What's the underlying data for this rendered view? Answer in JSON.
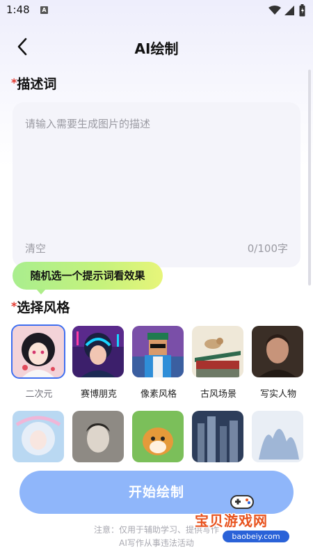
{
  "status_bar": {
    "time": "1:48",
    "notification_icon": "A"
  },
  "header": {
    "title": "AI绘制",
    "back_icon": "chevron-left"
  },
  "description": {
    "label": "描述词",
    "required_mark": "*",
    "placeholder": "请输入需要生成图片的描述",
    "clear_label": "清空",
    "counter": "0/100字"
  },
  "random_prompt_button": "随机选一个提示词看效果",
  "styles": {
    "label": "选择风格",
    "required_mark": "*",
    "items": [
      {
        "label": "二次元",
        "selected": true
      },
      {
        "label": "赛博朋克",
        "selected": false
      },
      {
        "label": "像素风格",
        "selected": false
      },
      {
        "label": "古风场景",
        "selected": false
      },
      {
        "label": "写实人物",
        "selected": false
      },
      {
        "label": "",
        "selected": false
      },
      {
        "label": "",
        "selected": false
      },
      {
        "label": "",
        "selected": false
      },
      {
        "label": "",
        "selected": false
      },
      {
        "label": "",
        "selected": false
      }
    ]
  },
  "start_button": "开始绘制",
  "notice": {
    "line1": "注意：仅用于辅助学习、提供写作",
    "line2": "AI写作从事违法活动"
  },
  "watermark": {
    "text": "宝贝游戏网",
    "url": "baobeiy.com"
  },
  "colors": {
    "accent": "#3e6ef0",
    "start_button": "#8fb6fa",
    "required": "#e2392f"
  }
}
